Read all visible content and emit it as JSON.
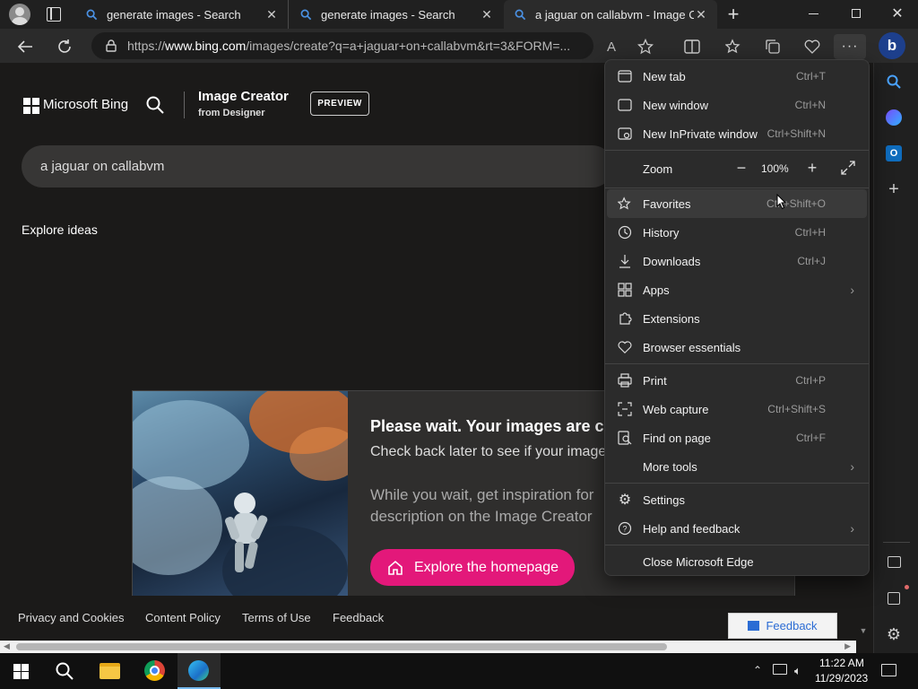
{
  "browser": {
    "tabs": [
      {
        "title": "generate images - Search"
      },
      {
        "title": "generate images - Search"
      },
      {
        "title": "a jaguar on callabvm - Image Cre"
      }
    ],
    "url_prefix": "https://",
    "url_domain": "www.bing.com",
    "url_rest": "/images/create?q=a+jaguar+on+callabvm&rt=3&FORM=..."
  },
  "page": {
    "brand": "Microsoft Bing",
    "product_title": "Image Creator",
    "product_sub": "from Designer",
    "preview_badge": "PREVIEW",
    "search_value": "a jaguar on callabvm",
    "explore_heading": "Explore ideas",
    "wait_title": "Please wait. Your images are c",
    "wait_line1": "Check back later to see if your image",
    "wait_line2": "While you wait, get inspiration for",
    "wait_line3": "description on the Image Creator",
    "explore_button": "Explore the homepage",
    "footer_links": [
      "Privacy and Cookies",
      "Content Policy",
      "Terms of Use",
      "Feedback"
    ],
    "feedback_button": "Feedback"
  },
  "menu": {
    "items": [
      {
        "label": "New tab",
        "shortcut": "Ctrl+T"
      },
      {
        "label": "New window",
        "shortcut": "Ctrl+N"
      },
      {
        "label": "New InPrivate window",
        "shortcut": "Ctrl+Shift+N"
      },
      {
        "label": "Favorites",
        "shortcut": "Ctrl+Shift+O"
      },
      {
        "label": "History",
        "shortcut": "Ctrl+H"
      },
      {
        "label": "Downloads",
        "shortcut": "Ctrl+J"
      },
      {
        "label": "Apps",
        "shortcut": ""
      },
      {
        "label": "Extensions",
        "shortcut": ""
      },
      {
        "label": "Browser essentials",
        "shortcut": ""
      },
      {
        "label": "Print",
        "shortcut": "Ctrl+P"
      },
      {
        "label": "Web capture",
        "shortcut": "Ctrl+Shift+S"
      },
      {
        "label": "Find on page",
        "shortcut": "Ctrl+F"
      },
      {
        "label": "More tools",
        "shortcut": ""
      },
      {
        "label": "Settings",
        "shortcut": ""
      },
      {
        "label": "Help and feedback",
        "shortcut": ""
      },
      {
        "label": "Close Microsoft Edge",
        "shortcut": ""
      }
    ],
    "zoom_label": "Zoom",
    "zoom_value": "100%"
  },
  "taskbar": {
    "time": "11:22 AM",
    "date": "11/29/2023"
  },
  "colors": {
    "accent_pink": "#e3187a",
    "menu_bg": "#2b2b2b",
    "taskbar": "#101010"
  }
}
